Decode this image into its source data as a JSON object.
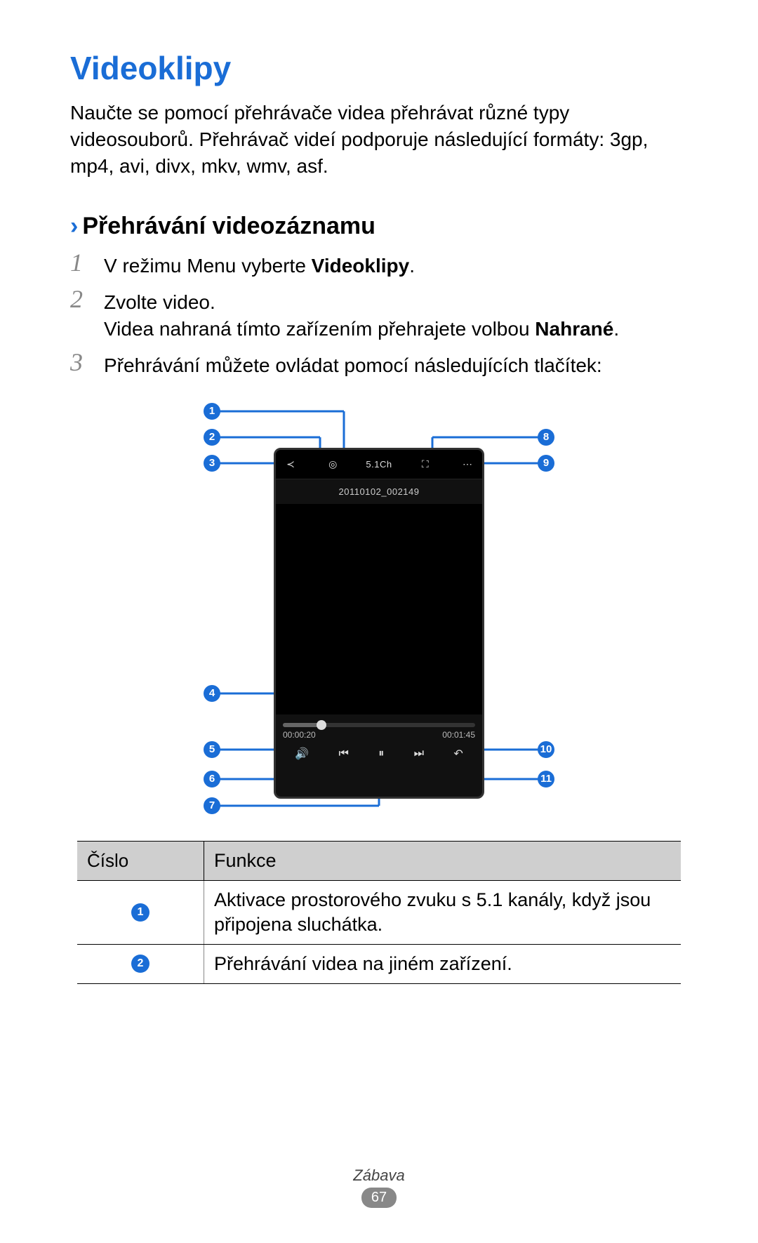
{
  "title": "Videoklipy",
  "intro": "Naučte se pomocí přehrávače videa přehrávat různé typy videosouborů. Přehrávač videí podporuje následující formáty: 3gp, mp4, avi, divx, mkv, wmv, asf.",
  "subheading": "Přehrávání videozáznamu",
  "steps": [
    {
      "num": "1",
      "text_before": "V režimu Menu vyberte ",
      "bold": "Videoklipy",
      "text_after": "."
    },
    {
      "num": "2",
      "line1": "Zvolte video.",
      "line2_before": "Videa nahraná tímto zařízením přehrajete volbou ",
      "line2_bold": "Nahrané",
      "line2_after": "."
    },
    {
      "num": "3",
      "text": "Přehrávání můžete ovládat pomocí následujících tlačítek:"
    }
  ],
  "diagram": {
    "video_filename": "20110102_002149",
    "time_elapsed": "00:00:20",
    "time_total": "00:01:45",
    "top_mid_label": "5.1Ch",
    "callouts_left": [
      "1",
      "2",
      "3",
      "4",
      "5",
      "6",
      "7"
    ],
    "callouts_right": [
      "8",
      "9",
      "10",
      "11"
    ]
  },
  "table": {
    "head_col1": "Číslo",
    "head_col2": "Funkce",
    "rows": [
      {
        "num": "1",
        "desc": "Aktivace prostorového zvuku s 5.1 kanály, když jsou připojena sluchátka."
      },
      {
        "num": "2",
        "desc": "Přehrávání videa na jiném zařízení."
      }
    ]
  },
  "footer": {
    "section": "Zábava",
    "page": "67"
  }
}
